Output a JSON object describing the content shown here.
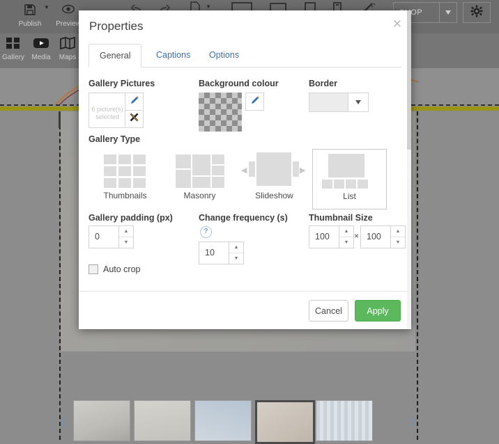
{
  "app": {
    "toolbar": {
      "items": [
        {
          "label": "Publish",
          "icon": "save-disk-icon"
        },
        {
          "label": "Preview",
          "icon": "eye-icon"
        },
        {
          "label": "Gallery",
          "icon": "grid-icon"
        },
        {
          "label": "Media",
          "icon": "video-play-icon"
        },
        {
          "label": "Maps",
          "icon": "map-icon"
        }
      ],
      "undo_icon": "undo-arrow-icon",
      "redo_icon": "redo-arrow-icon",
      "page_icon": "page-icon",
      "device_icons": [
        "desktop-icon",
        "laptop-icon",
        "tablet-icon",
        "phone-icon"
      ],
      "wand_icon": "magic-wand-icon",
      "shop_select": "SHOP",
      "gear_icon": "gear-icon"
    },
    "canvas": {
      "move_handle_icon": "move-arrows-icon",
      "strip_prev_icon": "chevron-left-icon",
      "strip_next_icon": "chevron-right-icon",
      "selected_thumb_index": 3
    }
  },
  "dialog": {
    "title": "Properties",
    "close_icon": "close-icon",
    "tabs": [
      {
        "label": "General",
        "active": true
      },
      {
        "label": "Captions",
        "active": false
      },
      {
        "label": "Options",
        "active": false
      }
    ],
    "gallery_pictures": {
      "label": "Gallery Pictures",
      "status": "6 picture(s) selected",
      "edit_icon": "pencil-icon",
      "remove_icon": "x-icon"
    },
    "background_colour": {
      "label": "Background colour",
      "swatch": "transparent",
      "edit_icon": "pencil-icon"
    },
    "border": {
      "label": "Border",
      "value": "",
      "caret_icon": "chevron-down-icon"
    },
    "gallery_type": {
      "label": "Gallery Type",
      "options": [
        {
          "label": "Thumbnails",
          "selected": false
        },
        {
          "label": "Masonry",
          "selected": false
        },
        {
          "label": "Slideshow",
          "selected": false
        },
        {
          "label": "List",
          "selected": true
        }
      ],
      "slideshow_prev_icon": "triangle-left-icon",
      "slideshow_next_icon": "triangle-right-icon"
    },
    "gallery_padding": {
      "label": "Gallery padding (px)",
      "value": "0",
      "up_icon": "caret-up-icon",
      "down_icon": "caret-down-icon"
    },
    "change_frequency": {
      "label": "Change frequency (s)",
      "value": "10",
      "help_icon": "question-mark-icon",
      "help_label": "?",
      "up_icon": "caret-up-icon",
      "down_icon": "caret-down-icon"
    },
    "thumbnail_size": {
      "label": "Thumbnail Size",
      "width": "100",
      "height": "100",
      "separator": "×"
    },
    "auto_crop": {
      "label": "Auto crop",
      "checked": false
    },
    "footer": {
      "cancel_label": "Cancel",
      "apply_label": "Apply",
      "apply_color": "#5cb85c"
    }
  }
}
